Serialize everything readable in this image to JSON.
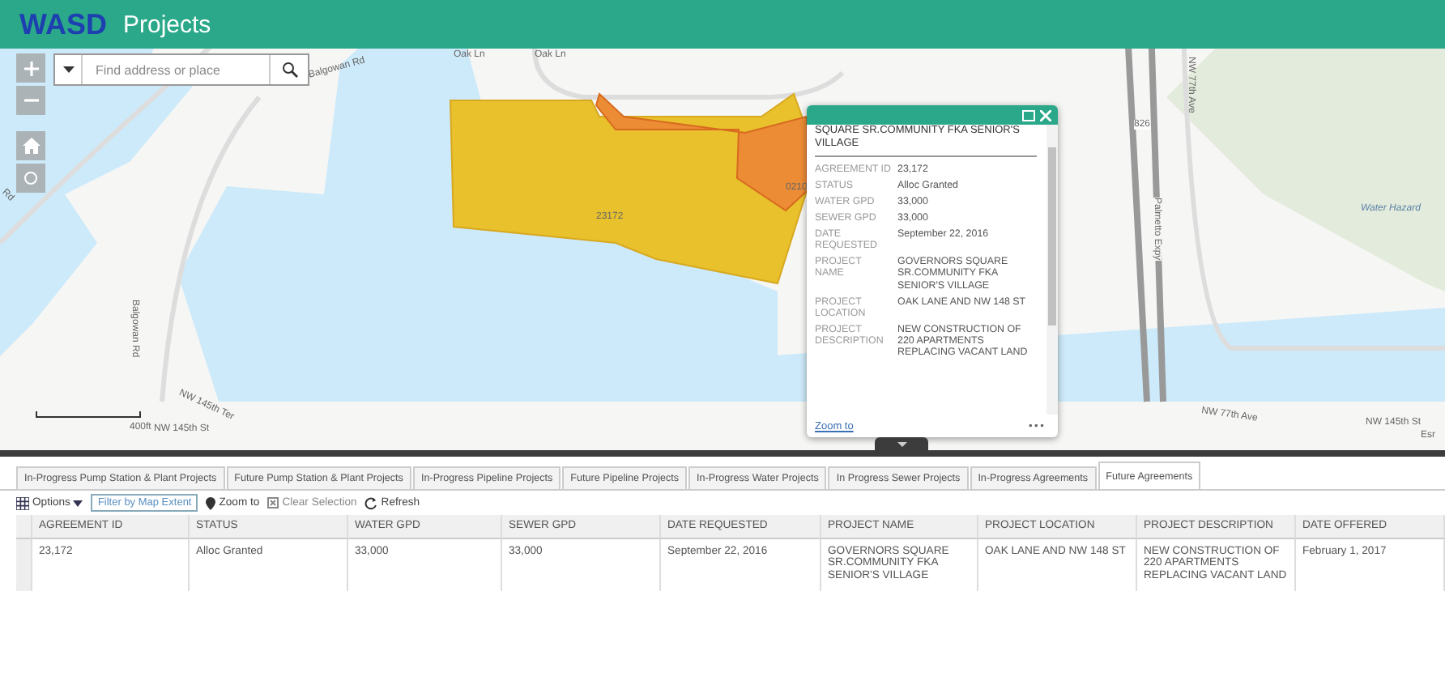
{
  "header": {
    "logo": "WASD",
    "title": "Projects"
  },
  "search": {
    "placeholder": "Find address or place"
  },
  "map_labels": [
    {
      "text": "Balgowan Rd"
    },
    {
      "text": "Oak Ln"
    },
    {
      "text": "Oak Ln"
    },
    {
      "text": "23172"
    },
    {
      "text": "0210"
    },
    {
      "text": "826"
    },
    {
      "text": "Palmetto Expy"
    },
    {
      "text": "NW 77th Ave"
    },
    {
      "text": "Water Hazard"
    },
    {
      "text": "NW 77th Ave"
    },
    {
      "text": "NW 145th St"
    },
    {
      "text": "Esr"
    },
    {
      "text": "Balgowan Rd"
    },
    {
      "text": "NW 145th Ter"
    },
    {
      "text": "NW 145th St"
    },
    {
      "text": "Rd"
    }
  ],
  "scale": {
    "label": "400ft"
  },
  "popup": {
    "title": "SQUARE SR.COMMUNITY FKA SENIOR'S VILLAGE",
    "fields": [
      {
        "label": "AGREEMENT ID",
        "value": "23,172"
      },
      {
        "label": "STATUS",
        "value": "Alloc Granted"
      },
      {
        "label": "WATER GPD",
        "value": "33,000"
      },
      {
        "label": "SEWER GPD",
        "value": "33,000"
      },
      {
        "label": "DATE REQUESTED",
        "value": "September 22, 2016"
      },
      {
        "label": "PROJECT NAME",
        "value": "GOVERNORS SQUARE SR.COMMUNITY FKA SENIOR'S VILLAGE"
      },
      {
        "label": "PROJECT LOCATION",
        "value": "OAK LANE AND NW 148 ST"
      },
      {
        "label": "PROJECT DESCRIPTION",
        "value": "NEW CONSTRUCTION OF 220 APARTMENTS REPLACING VACANT LAND"
      }
    ],
    "link": "Zoom to",
    "more": "•••"
  },
  "tabs": [
    {
      "label": "In-Progress Pump Station & Plant Projects",
      "selected": false
    },
    {
      "label": "Future Pump Station & Plant Projects",
      "selected": false
    },
    {
      "label": "In-Progress Pipeline Projects",
      "selected": false
    },
    {
      "label": "Future Pipeline Projects",
      "selected": false
    },
    {
      "label": "In-Progress Water Projects",
      "selected": false
    },
    {
      "label": "In Progress Sewer Projects",
      "selected": false
    },
    {
      "label": "In-Progress Agreements",
      "selected": false
    },
    {
      "label": "Future Agreements",
      "selected": true
    }
  ],
  "toolbar": {
    "options": "Options",
    "filter": "Filter by Map Extent",
    "zoom": "Zoom to",
    "clear": "Clear Selection",
    "refresh": "Refresh"
  },
  "table": {
    "columns": [
      "AGREEMENT ID",
      "STATUS",
      "WATER GPD",
      "SEWER GPD",
      "DATE REQUESTED",
      "PROJECT NAME",
      "PROJECT LOCATION",
      "PROJECT DESCRIPTION",
      "DATE OFFERED"
    ],
    "rows": [
      [
        "23,172",
        "Alloc Granted",
        "33,000",
        "33,000",
        "September 22, 2016",
        "GOVERNORS SQUARE SR.COMMUNITY FKA SENIOR'S VILLAGE",
        "OAK LANE AND NW 148 ST",
        "NEW CONSTRUCTION OF 220 APARTMENTS REPLACING VACANT LAND",
        "February 1, 2017"
      ]
    ]
  }
}
